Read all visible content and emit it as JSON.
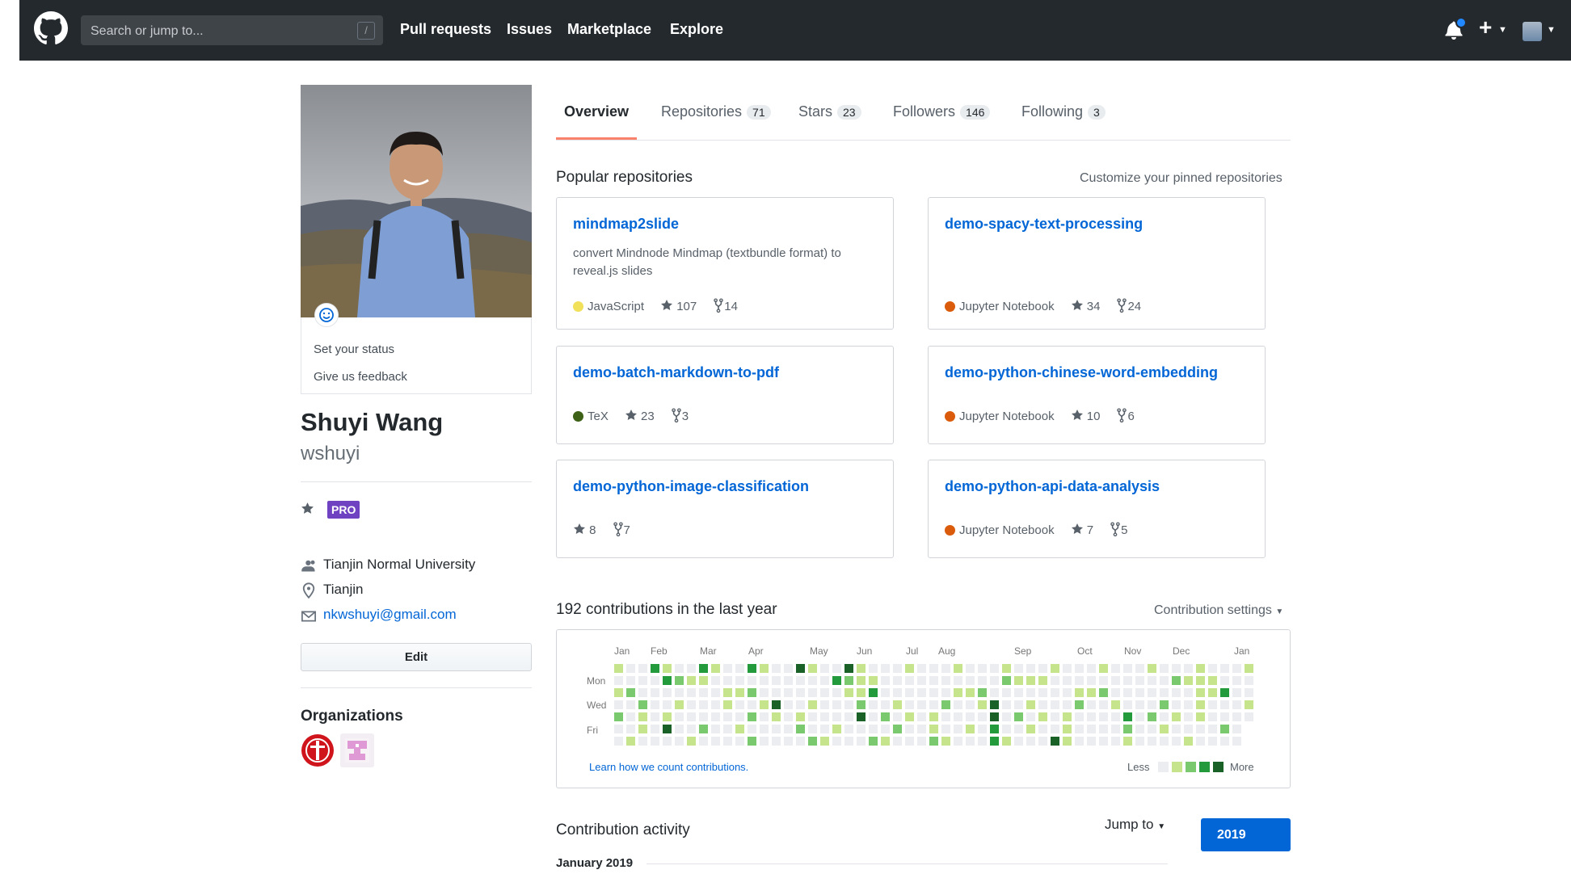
{
  "header": {
    "search_placeholder": "Search or jump to...",
    "search_shortcut": "/",
    "nav": [
      "Pull requests",
      "Issues",
      "Marketplace",
      "Explore"
    ],
    "plus_label": "+"
  },
  "profile": {
    "status_link": "Set your status",
    "feedback_link": "Give us feedback",
    "full_name": "Shuyi Wang",
    "username": "wshuyi",
    "badge": "PRO",
    "organization": "Tianjin Normal University",
    "location": "Tianjin",
    "email": "nkwshuyi@gmail.com",
    "edit_label": "Edit",
    "organizations_title": "Organizations"
  },
  "tabs": [
    {
      "label": "Overview",
      "count": ""
    },
    {
      "label": "Repositories",
      "count": "71"
    },
    {
      "label": "Stars",
      "count": "23"
    },
    {
      "label": "Followers",
      "count": "146"
    },
    {
      "label": "Following",
      "count": "3"
    }
  ],
  "pinned": {
    "title": "Popular repositories",
    "customize": "Customize your pinned repositories",
    "repos": [
      {
        "name": "mindmap2slide",
        "desc": "convert Mindnode Mindmap (textbundle format) to reveal.js slides",
        "lang": "JavaScript",
        "lang_color": "#f1e05a",
        "stars": "107",
        "forks": "14"
      },
      {
        "name": "demo-spacy-text-processing",
        "desc": "",
        "lang": "Jupyter Notebook",
        "lang_color": "#DA5B0B",
        "stars": "34",
        "forks": "24"
      },
      {
        "name": "demo-batch-markdown-to-pdf",
        "desc": "",
        "lang": "TeX",
        "lang_color": "#3D6117",
        "stars": "23",
        "forks": "3"
      },
      {
        "name": "demo-python-chinese-word-embedding",
        "desc": "",
        "lang": "Jupyter Notebook",
        "lang_color": "#DA5B0B",
        "stars": "10",
        "forks": "6"
      },
      {
        "name": "demo-python-image-classification",
        "desc": "",
        "lang": "",
        "lang_color": "",
        "stars": "8",
        "forks": "7"
      },
      {
        "name": "demo-python-api-data-analysis",
        "desc": "",
        "lang": "Jupyter Notebook",
        "lang_color": "#DA5B0B",
        "stars": "7",
        "forks": "5"
      }
    ]
  },
  "contributions": {
    "title": "192 contributions in the last year",
    "settings": "Contribution settings",
    "months": [
      "Jan",
      "Feb",
      "Mar",
      "Apr",
      "May",
      "Jun",
      "Jul",
      "Aug",
      "Sep",
      "Oct",
      "Nov",
      "Dec",
      "Jan"
    ],
    "weekdays": [
      "Mon",
      "Wed",
      "Fri"
    ],
    "learn_link": "Learn how we count contributions.",
    "legend_less": "Less",
    "legend_more": "More",
    "colors": [
      "#ebedf0",
      "#c6e48b",
      "#7bc96f",
      "#239a3b",
      "#196127"
    ]
  },
  "activity": {
    "title": "Contribution activity",
    "jump_to": "Jump to",
    "year": "2019",
    "month_header": "January 2019"
  }
}
